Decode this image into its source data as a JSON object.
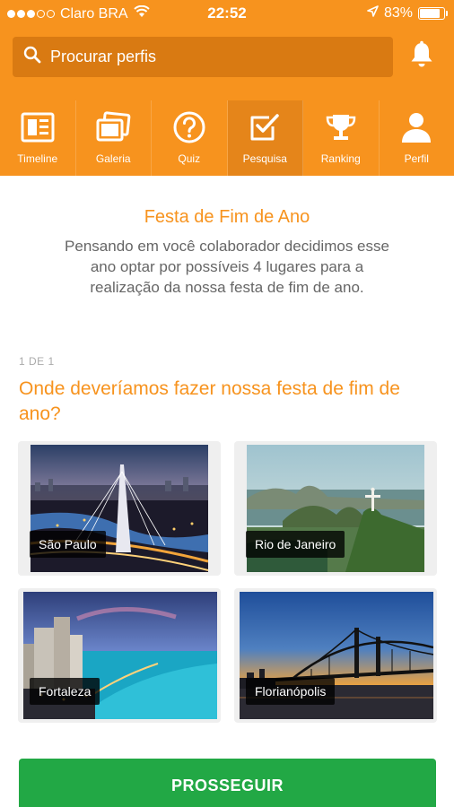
{
  "status_bar": {
    "carrier": "Claro BRA",
    "time": "22:52",
    "battery": "83%",
    "battery_level": 0.83,
    "signal_icon": "signal-dots-icon",
    "wifi_icon": "wifi-icon",
    "location_icon": "location-arrow-icon"
  },
  "search": {
    "placeholder": "Procurar perfis",
    "icon": "search-icon"
  },
  "notifications": {
    "icon": "bell-icon"
  },
  "nav": {
    "items": [
      {
        "label": "Timeline",
        "icon": "timeline-icon"
      },
      {
        "label": "Galeria",
        "icon": "gallery-icon"
      },
      {
        "label": "Quiz",
        "icon": "question-icon"
      },
      {
        "label": "Pesquisa",
        "icon": "checkbox-icon",
        "active": true
      },
      {
        "label": "Ranking",
        "icon": "trophy-icon"
      },
      {
        "label": "Perfil",
        "icon": "user-icon"
      }
    ]
  },
  "survey": {
    "title": "Festa de Fim de Ano",
    "description": "Pensando em você colaborador decidimos esse ano optar por possíveis 4 lugares para a realização da nossa festa de fim de ano.",
    "counter": "1 DE 1",
    "question": "Onde deveríamos fazer nossa festa de fim de ano?",
    "options": [
      {
        "label": "São Paulo"
      },
      {
        "label": "Rio de Janeiro"
      },
      {
        "label": "Fortaleza"
      },
      {
        "label": "Florianópolis"
      }
    ],
    "proceed_label": "PROSSEGUIR"
  },
  "colors": {
    "brand_orange": "#f7931e",
    "search_bg": "#d97a12",
    "active_tab": "#e5851a",
    "proceed_green": "#22a845"
  }
}
